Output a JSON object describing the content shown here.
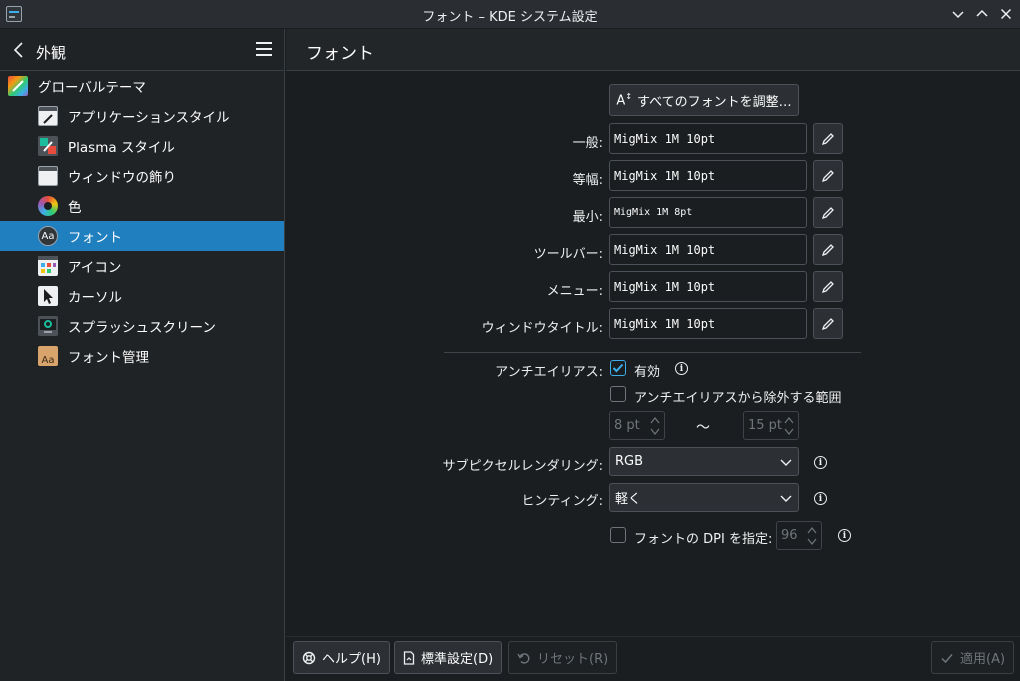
{
  "window": {
    "title": "フォント – KDE システム設定"
  },
  "sidebar": {
    "header": "外観",
    "items": [
      {
        "label": "グローバルテーマ",
        "icon": "global-theme-icon"
      },
      {
        "label": "アプリケーションスタイル",
        "icon": "application-style-icon"
      },
      {
        "label": "Plasma スタイル",
        "icon": "plasma-style-icon"
      },
      {
        "label": "ウィンドウの飾り",
        "icon": "window-decoration-icon"
      },
      {
        "label": "色",
        "icon": "colors-icon"
      },
      {
        "label": "フォント",
        "icon": "fonts-icon",
        "active": true
      },
      {
        "label": "アイコン",
        "icon": "icons-icon"
      },
      {
        "label": "カーソル",
        "icon": "cursor-icon"
      },
      {
        "label": "スプラッシュスクリーン",
        "icon": "splash-screen-icon"
      },
      {
        "label": "フォント管理",
        "icon": "font-management-icon"
      }
    ]
  },
  "page": {
    "title": "フォント"
  },
  "fonts": {
    "adjust_all": "すべてのフォントを調整…",
    "rows": [
      {
        "label": "一般:",
        "value": "MigMix 1M 10pt"
      },
      {
        "label": "等幅:",
        "value": "MigMix 1M 10pt"
      },
      {
        "label": "最小:",
        "value": "MigMix 1M 8pt"
      },
      {
        "label": "ツールバー:",
        "value": "MigMix 1M 10pt"
      },
      {
        "label": "メニュー:",
        "value": "MigMix 1M 10pt"
      },
      {
        "label": "ウィンドウタイトル:",
        "value": "MigMix 1M 10pt"
      }
    ]
  },
  "antialiasing": {
    "label": "アンチエイリアス:",
    "enabled_label": "有効",
    "enabled": true,
    "exclude_label": "アンチエイリアスから除外する範囲",
    "exclude": false,
    "range_from": "8 pt",
    "range_sep": "～",
    "range_to": "15 pt"
  },
  "subpixel": {
    "label": "サブピクセルレンダリング:",
    "value": "RGB"
  },
  "hinting": {
    "label": "ヒンティング:",
    "value": "軽く"
  },
  "dpi": {
    "label": "フォントの DPI を指定:",
    "value": "96",
    "enabled": false
  },
  "footer": {
    "help": "ヘルプ(H)",
    "defaults": "標準設定(D)",
    "reset": "リセット(R)",
    "apply": "適用(A)"
  },
  "colors": {
    "accent": "#3daee9",
    "selection": "#1f7fbf",
    "background": "#1b1e20"
  }
}
